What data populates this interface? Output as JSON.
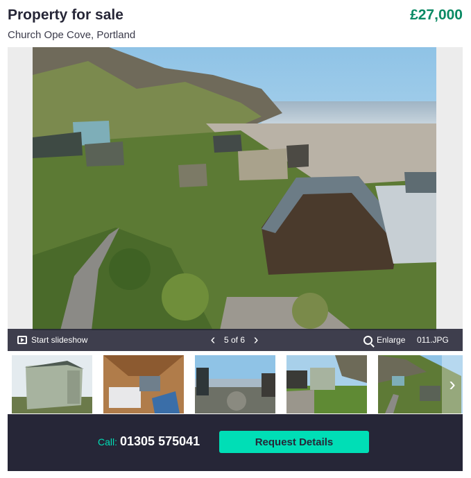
{
  "listing": {
    "title": "Property for sale",
    "address": "Church Ope Cove, Portland",
    "price": "£27,000"
  },
  "gallery": {
    "slideshow_label": "Start slideshow",
    "pager_text": "5 of 6",
    "prev_icon": "chevron-left-icon",
    "next_icon": "chevron-right-icon",
    "enlarge_label": "Enlarge",
    "filename": "011.JPG",
    "thumbnails": [
      {
        "name": "thumbnail-beach-hut-exterior"
      },
      {
        "name": "thumbnail-beach-hut-interior"
      },
      {
        "name": "thumbnail-rocky-shore"
      },
      {
        "name": "thumbnail-hut-with-wall"
      },
      {
        "name": "thumbnail-hillside-huts"
      }
    ]
  },
  "contact": {
    "call_label": "Call:",
    "phone": "01305 575041",
    "request_label": "Request Details"
  },
  "colors": {
    "price_green": "#0a8a64",
    "accent_mint": "#00deb6",
    "dark_navy": "#262637"
  }
}
